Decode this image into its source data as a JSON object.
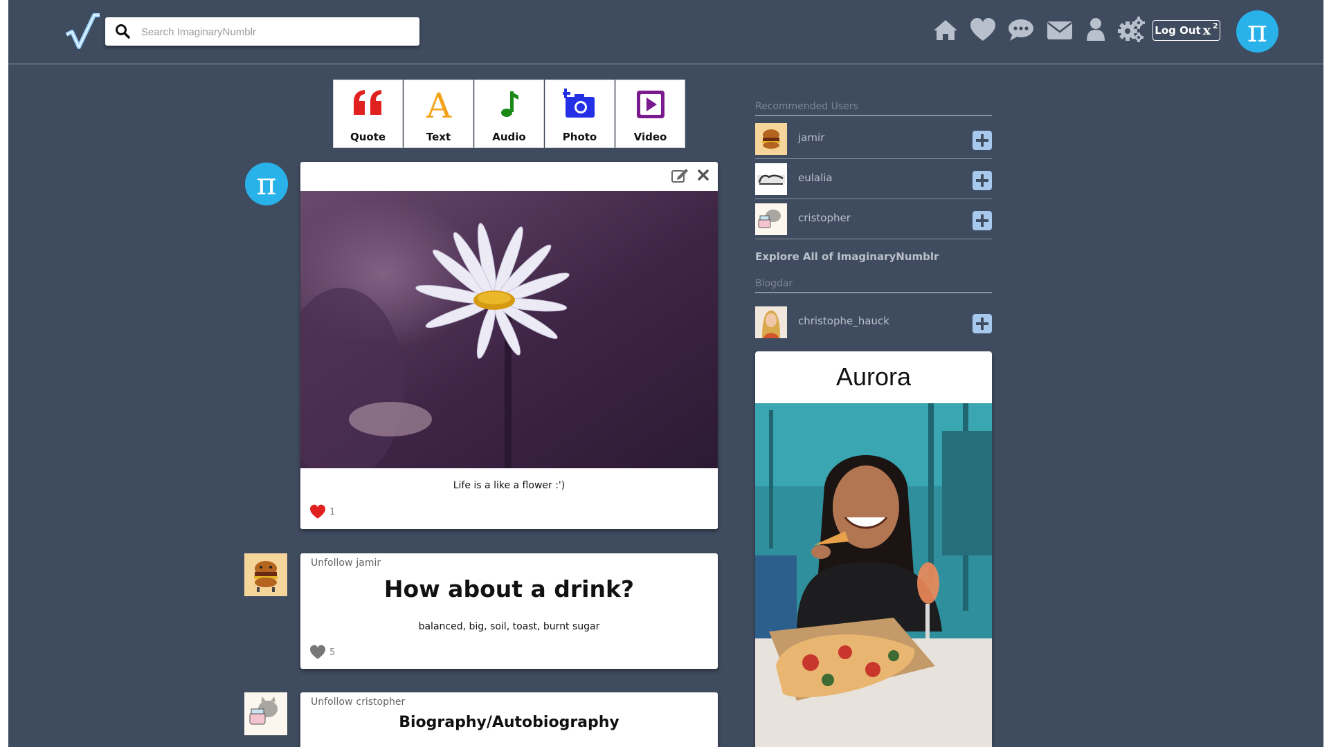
{
  "header": {
    "search_placeholder": "Search ImaginaryNumblr",
    "nav_icons": [
      "home-icon",
      "heart-icon",
      "chat-icon",
      "mail-icon",
      "user-icon",
      "gear-icon"
    ],
    "logout_label": "Log Out",
    "logout_symbol": "x",
    "logout_exponent": "2",
    "avatar_symbol": "π"
  },
  "post_types": [
    {
      "label": "Quote",
      "icon": "quote-icon",
      "color": "#e0211f"
    },
    {
      "label": "Text",
      "icon": "text-icon",
      "color": "#f4a21a"
    },
    {
      "label": "Audio",
      "icon": "music-note-icon",
      "color": "#1a8a14"
    },
    {
      "label": "Photo",
      "icon": "camera-icon",
      "color": "#2430e6"
    },
    {
      "label": "Video",
      "icon": "video-play-icon",
      "color": "#7a1a8c"
    }
  ],
  "feed": {
    "post1": {
      "avatar_symbol": "π",
      "caption": "Life is a like a flower :')",
      "likes": "1"
    },
    "post2": {
      "unfollow_label": "Unfollow",
      "user": "jamir",
      "title": "How about a drink?",
      "body": "balanced, big, soil, toast, burnt sugar",
      "likes": "5"
    },
    "post3": {
      "unfollow_label": "Unfollow",
      "user": "cristopher",
      "title": "Biography/Autobiography"
    }
  },
  "sidebar": {
    "recommended_heading": "Recommended Users",
    "recommended": [
      {
        "name": "jamir"
      },
      {
        "name": "eulalia"
      },
      {
        "name": "cristopher"
      }
    ],
    "explore_label": "Explore All of ImaginaryNumblr",
    "blogdar_heading": "Blogdar",
    "blogdar_user": {
      "name": "christophe_hauck"
    },
    "featured_card_title": "Aurora"
  },
  "colors": {
    "background": "#3f4b5e",
    "accent": "#29b1ea",
    "like_red": "#e0211f",
    "add_button": "#a8c9ee"
  }
}
